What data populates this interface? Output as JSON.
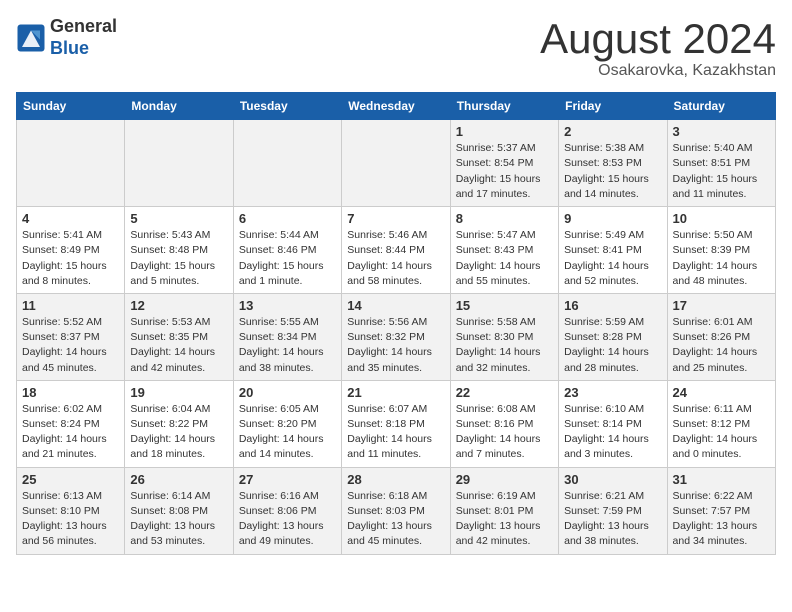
{
  "header": {
    "logo_general": "General",
    "logo_blue": "Blue",
    "month_title": "August 2024",
    "location": "Osakarovka, Kazakhstan"
  },
  "weekdays": [
    "Sunday",
    "Monday",
    "Tuesday",
    "Wednesday",
    "Thursday",
    "Friday",
    "Saturday"
  ],
  "weeks": [
    [
      {
        "day": "",
        "info": ""
      },
      {
        "day": "",
        "info": ""
      },
      {
        "day": "",
        "info": ""
      },
      {
        "day": "",
        "info": ""
      },
      {
        "day": "1",
        "info": "Sunrise: 5:37 AM\nSunset: 8:54 PM\nDaylight: 15 hours and 17 minutes."
      },
      {
        "day": "2",
        "info": "Sunrise: 5:38 AM\nSunset: 8:53 PM\nDaylight: 15 hours and 14 minutes."
      },
      {
        "day": "3",
        "info": "Sunrise: 5:40 AM\nSunset: 8:51 PM\nDaylight: 15 hours and 11 minutes."
      }
    ],
    [
      {
        "day": "4",
        "info": "Sunrise: 5:41 AM\nSunset: 8:49 PM\nDaylight: 15 hours and 8 minutes."
      },
      {
        "day": "5",
        "info": "Sunrise: 5:43 AM\nSunset: 8:48 PM\nDaylight: 15 hours and 5 minutes."
      },
      {
        "day": "6",
        "info": "Sunrise: 5:44 AM\nSunset: 8:46 PM\nDaylight: 15 hours and 1 minute."
      },
      {
        "day": "7",
        "info": "Sunrise: 5:46 AM\nSunset: 8:44 PM\nDaylight: 14 hours and 58 minutes."
      },
      {
        "day": "8",
        "info": "Sunrise: 5:47 AM\nSunset: 8:43 PM\nDaylight: 14 hours and 55 minutes."
      },
      {
        "day": "9",
        "info": "Sunrise: 5:49 AM\nSunset: 8:41 PM\nDaylight: 14 hours and 52 minutes."
      },
      {
        "day": "10",
        "info": "Sunrise: 5:50 AM\nSunset: 8:39 PM\nDaylight: 14 hours and 48 minutes."
      }
    ],
    [
      {
        "day": "11",
        "info": "Sunrise: 5:52 AM\nSunset: 8:37 PM\nDaylight: 14 hours and 45 minutes."
      },
      {
        "day": "12",
        "info": "Sunrise: 5:53 AM\nSunset: 8:35 PM\nDaylight: 14 hours and 42 minutes."
      },
      {
        "day": "13",
        "info": "Sunrise: 5:55 AM\nSunset: 8:34 PM\nDaylight: 14 hours and 38 minutes."
      },
      {
        "day": "14",
        "info": "Sunrise: 5:56 AM\nSunset: 8:32 PM\nDaylight: 14 hours and 35 minutes."
      },
      {
        "day": "15",
        "info": "Sunrise: 5:58 AM\nSunset: 8:30 PM\nDaylight: 14 hours and 32 minutes."
      },
      {
        "day": "16",
        "info": "Sunrise: 5:59 AM\nSunset: 8:28 PM\nDaylight: 14 hours and 28 minutes."
      },
      {
        "day": "17",
        "info": "Sunrise: 6:01 AM\nSunset: 8:26 PM\nDaylight: 14 hours and 25 minutes."
      }
    ],
    [
      {
        "day": "18",
        "info": "Sunrise: 6:02 AM\nSunset: 8:24 PM\nDaylight: 14 hours and 21 minutes."
      },
      {
        "day": "19",
        "info": "Sunrise: 6:04 AM\nSunset: 8:22 PM\nDaylight: 14 hours and 18 minutes."
      },
      {
        "day": "20",
        "info": "Sunrise: 6:05 AM\nSunset: 8:20 PM\nDaylight: 14 hours and 14 minutes."
      },
      {
        "day": "21",
        "info": "Sunrise: 6:07 AM\nSunset: 8:18 PM\nDaylight: 14 hours and 11 minutes."
      },
      {
        "day": "22",
        "info": "Sunrise: 6:08 AM\nSunset: 8:16 PM\nDaylight: 14 hours and 7 minutes."
      },
      {
        "day": "23",
        "info": "Sunrise: 6:10 AM\nSunset: 8:14 PM\nDaylight: 14 hours and 3 minutes."
      },
      {
        "day": "24",
        "info": "Sunrise: 6:11 AM\nSunset: 8:12 PM\nDaylight: 14 hours and 0 minutes."
      }
    ],
    [
      {
        "day": "25",
        "info": "Sunrise: 6:13 AM\nSunset: 8:10 PM\nDaylight: 13 hours and 56 minutes."
      },
      {
        "day": "26",
        "info": "Sunrise: 6:14 AM\nSunset: 8:08 PM\nDaylight: 13 hours and 53 minutes."
      },
      {
        "day": "27",
        "info": "Sunrise: 6:16 AM\nSunset: 8:06 PM\nDaylight: 13 hours and 49 minutes."
      },
      {
        "day": "28",
        "info": "Sunrise: 6:18 AM\nSunset: 8:03 PM\nDaylight: 13 hours and 45 minutes."
      },
      {
        "day": "29",
        "info": "Sunrise: 6:19 AM\nSunset: 8:01 PM\nDaylight: 13 hours and 42 minutes."
      },
      {
        "day": "30",
        "info": "Sunrise: 6:21 AM\nSunset: 7:59 PM\nDaylight: 13 hours and 38 minutes."
      },
      {
        "day": "31",
        "info": "Sunrise: 6:22 AM\nSunset: 7:57 PM\nDaylight: 13 hours and 34 minutes."
      }
    ]
  ]
}
